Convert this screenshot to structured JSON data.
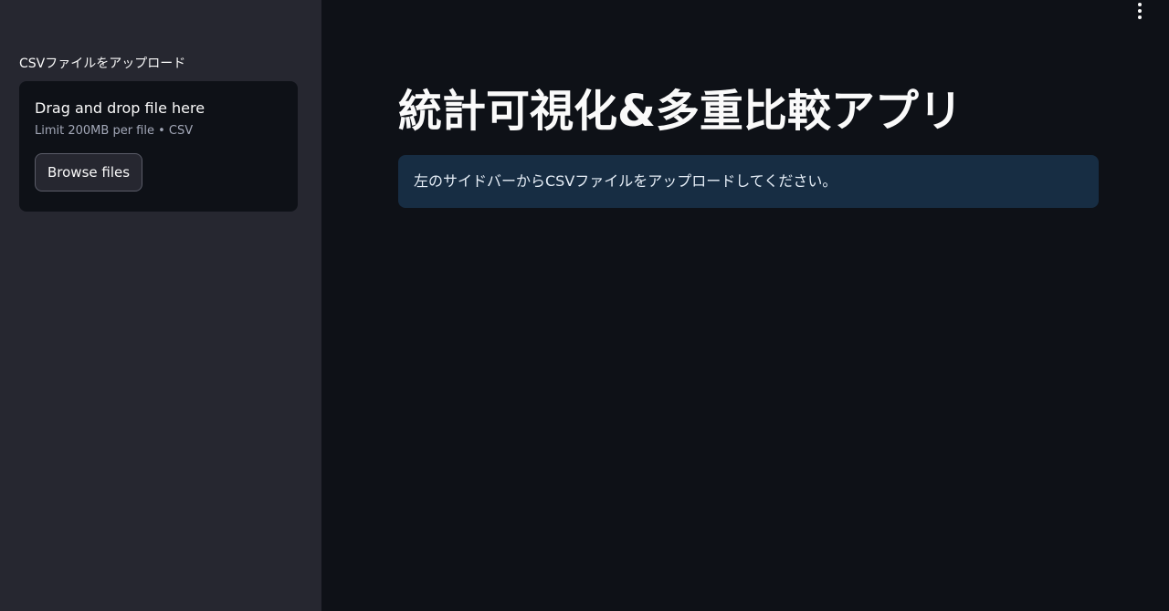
{
  "sidebar": {
    "uploader": {
      "label": "CSVファイルをアップロード",
      "instruction": "Drag and drop file here",
      "limit": "Limit 200MB per file • CSV",
      "browse_label": "Browse files"
    }
  },
  "main": {
    "title": "統計可視化&多重比較アプリ",
    "info_message": "左のサイドバーからCSVファイルをアップロードしてください。",
    "menu_icon": "more-vertical-icon"
  },
  "colors": {
    "sidebar_bg": "#262730",
    "main_bg": "#0e1117",
    "info_bg": "#172d43",
    "text": "#fafafa"
  }
}
